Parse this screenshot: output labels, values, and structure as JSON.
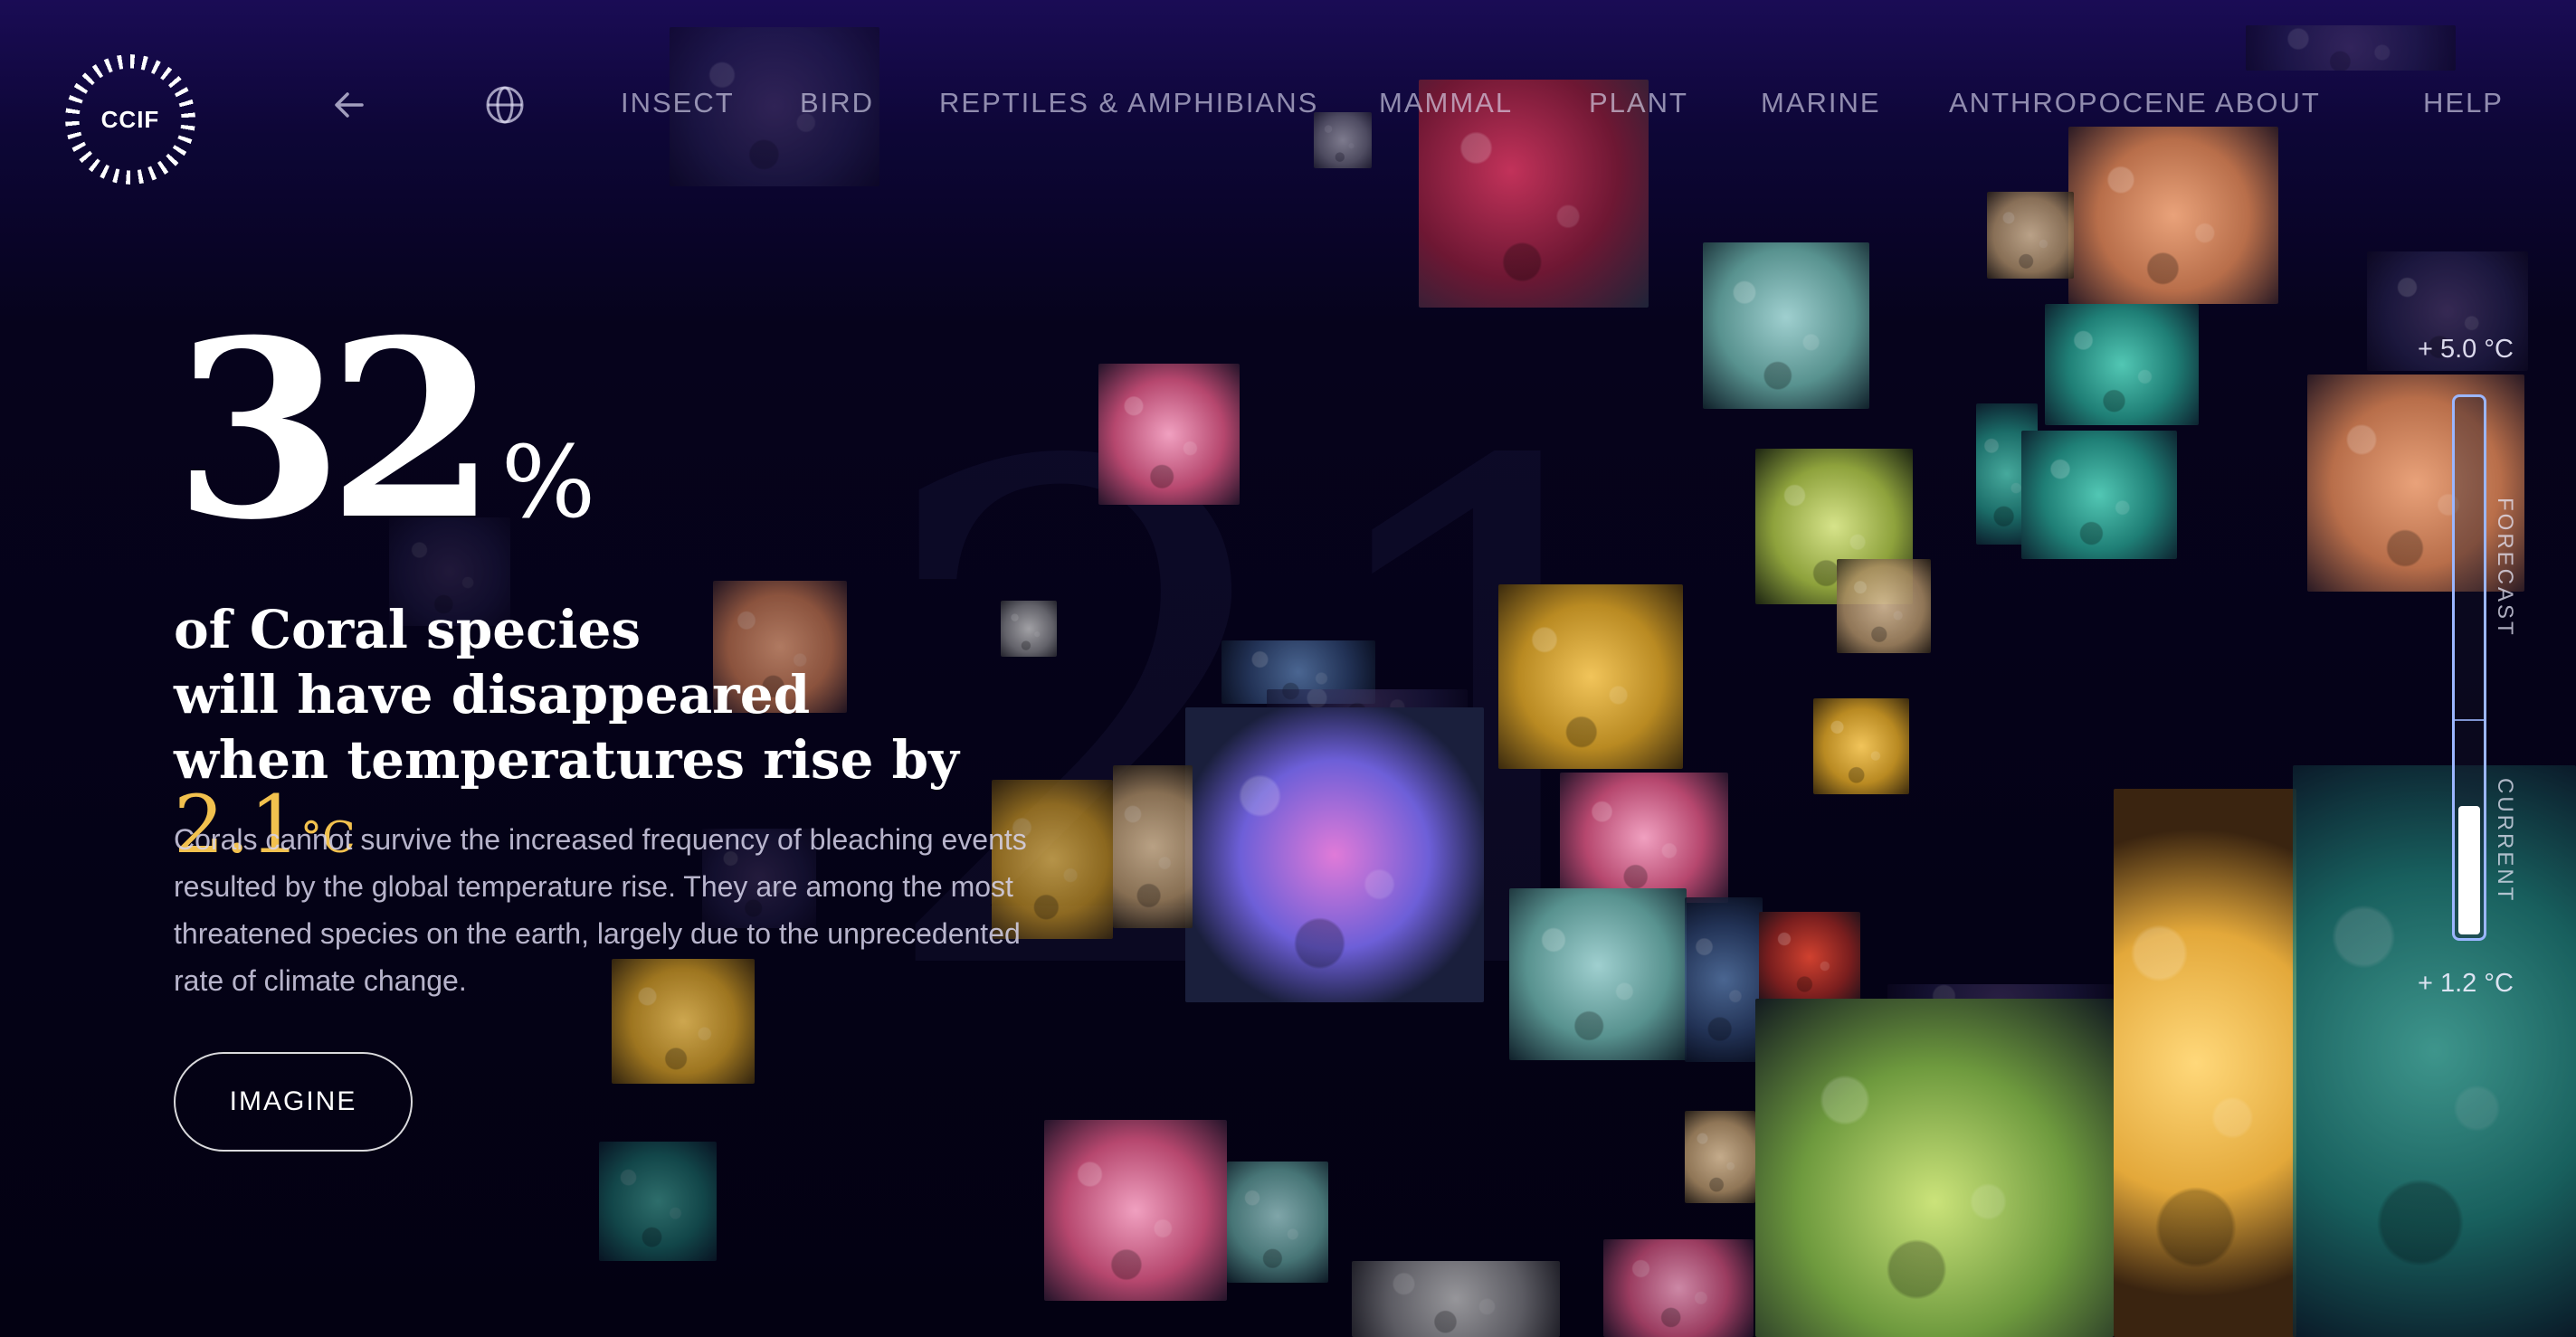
{
  "logo": {
    "text": "CCIF"
  },
  "nav": {
    "back_icon": "arrow-left-icon",
    "language_icon": "globe-icon",
    "items": [
      {
        "label": "INSECT"
      },
      {
        "label": "BIRD"
      },
      {
        "label": "REPTILES & AMPHIBIANS"
      },
      {
        "label": "MAMMAL"
      },
      {
        "label": "PLANT"
      },
      {
        "label": "MARINE"
      },
      {
        "label": "ANTHROPOCENE"
      },
      {
        "label": "ABOUT"
      },
      {
        "label": "HELP"
      }
    ]
  },
  "hero": {
    "stat_value": "32",
    "stat_unit": "%",
    "headline_line1": "of Coral species",
    "headline_line2": "will have disappeared",
    "headline_line3": "when temperatures rise by",
    "temperature_value": "2.1",
    "temperature_unit": "°C",
    "description": "Corals cannot survive the increased frequency of bleaching events resulted by the global temperature rise. They are among the most threatened species on the earth, largely due to the unprecedented rate of climate change.",
    "cta_label": "IMAGINE"
  },
  "slider": {
    "max_label": "+ 5.0 °C",
    "min_label": "+ 1.2 °C",
    "forecast_label": "FORECAST",
    "current_label": "CURRENT",
    "current_fraction": 0.24,
    "track_color": "#9bb6ff"
  },
  "colors": {
    "accent_temperature": "#f2c14e",
    "background_top": "#1a0c55",
    "background_bottom": "#030112"
  }
}
